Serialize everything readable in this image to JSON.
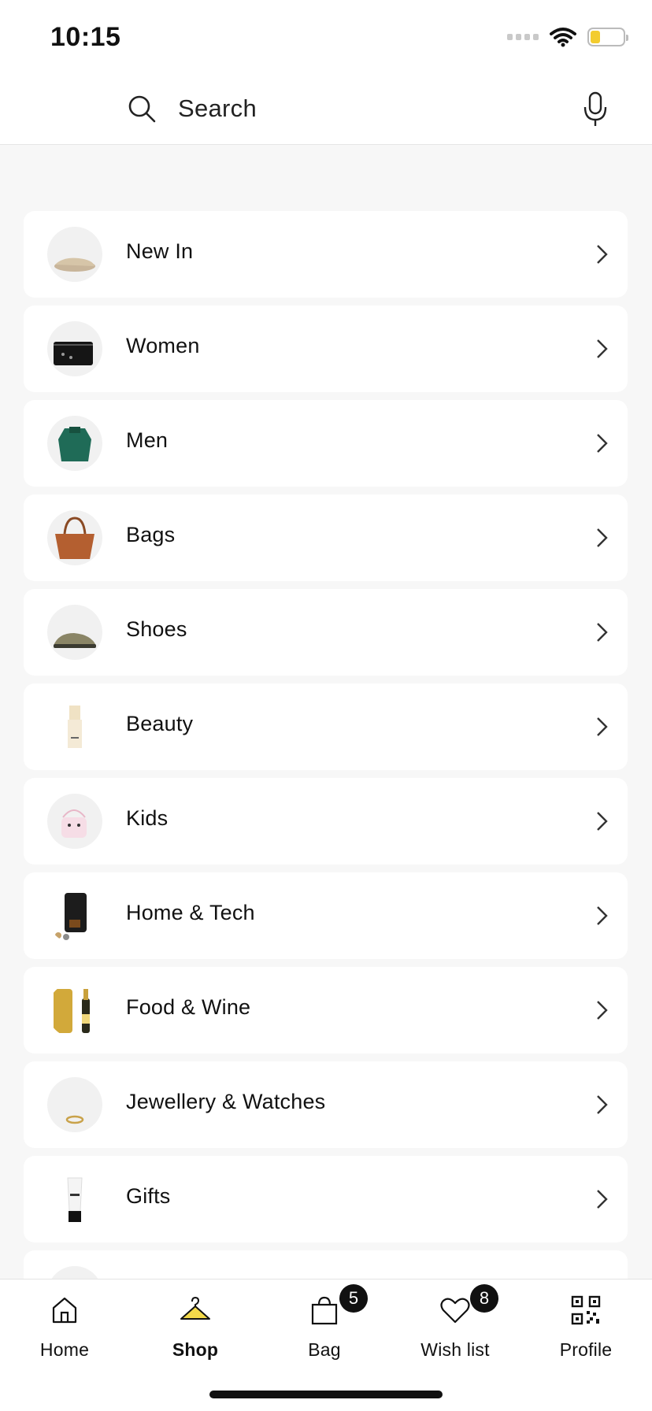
{
  "status_bar": {
    "time": "10:15"
  },
  "search": {
    "placeholder": "Search",
    "icon": "search-icon",
    "mic_icon": "microphone-icon"
  },
  "categories": [
    {
      "label": "New In",
      "thumb": "shoe-image"
    },
    {
      "label": "Women",
      "thumb": "handbag-image"
    },
    {
      "label": "Men",
      "thumb": "sweatshirt-image"
    },
    {
      "label": "Bags",
      "thumb": "woven-bag-image"
    },
    {
      "label": "Shoes",
      "thumb": "clog-image"
    },
    {
      "label": "Beauty",
      "thumb": "foundation-bottle-image"
    },
    {
      "label": "Kids",
      "thumb": "kids-bag-image"
    },
    {
      "label": "Home & Tech",
      "thumb": "coffee-machine-image"
    },
    {
      "label": "Food & Wine",
      "thumb": "champagne-image"
    },
    {
      "label": "Jewellery & Watches",
      "thumb": "ring-image"
    },
    {
      "label": "Gifts",
      "thumb": "cream-tube-image"
    }
  ],
  "tab_bar": {
    "tabs": [
      {
        "label": "Home",
        "icon": "home-icon"
      },
      {
        "label": "Shop",
        "icon": "hanger-icon",
        "active": true
      },
      {
        "label": "Bag",
        "icon": "shopping-bag-icon",
        "badge": "5"
      },
      {
        "label": "Wish list",
        "icon": "heart-icon",
        "badge": "8"
      },
      {
        "label": "Profile",
        "icon": "qr-code-icon"
      }
    ]
  },
  "colors": {
    "accent": "#f3d94a",
    "background": "#f7f7f7",
    "card": "#ffffff",
    "text": "#111111"
  }
}
